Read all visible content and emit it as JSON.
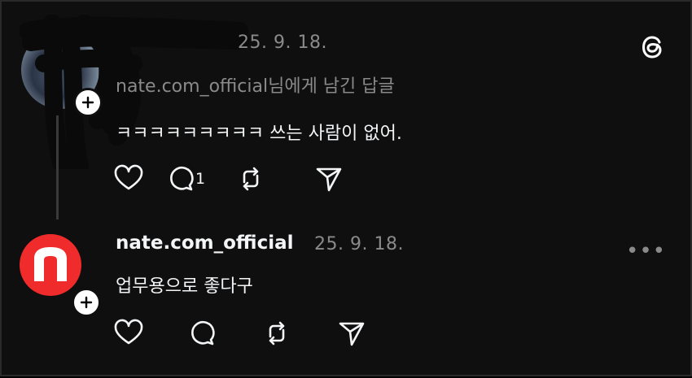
{
  "post1": {
    "date": "25. 9. 18.",
    "reply_to": "nate.com_official님에게 남긴 답글",
    "text": "ㅋㅋㅋㅋㅋㅋㅋㅋㅋ 쓰는 사람이 없어.",
    "comment_count": "1"
  },
  "post2": {
    "username": "nate.com_official",
    "date": "25. 9. 18.",
    "text": "업무용으로 좋다구",
    "more": "•••"
  },
  "icons": [
    "threads-logo-icon",
    "heart-icon",
    "comment-icon",
    "repost-icon",
    "share-icon",
    "plus-icon",
    "more-icon"
  ],
  "colors": {
    "background": "#0f0f0f",
    "text": "#f3f5f7",
    "secondary": "#8a8a8a",
    "nate_red": "#ef2b2b"
  }
}
